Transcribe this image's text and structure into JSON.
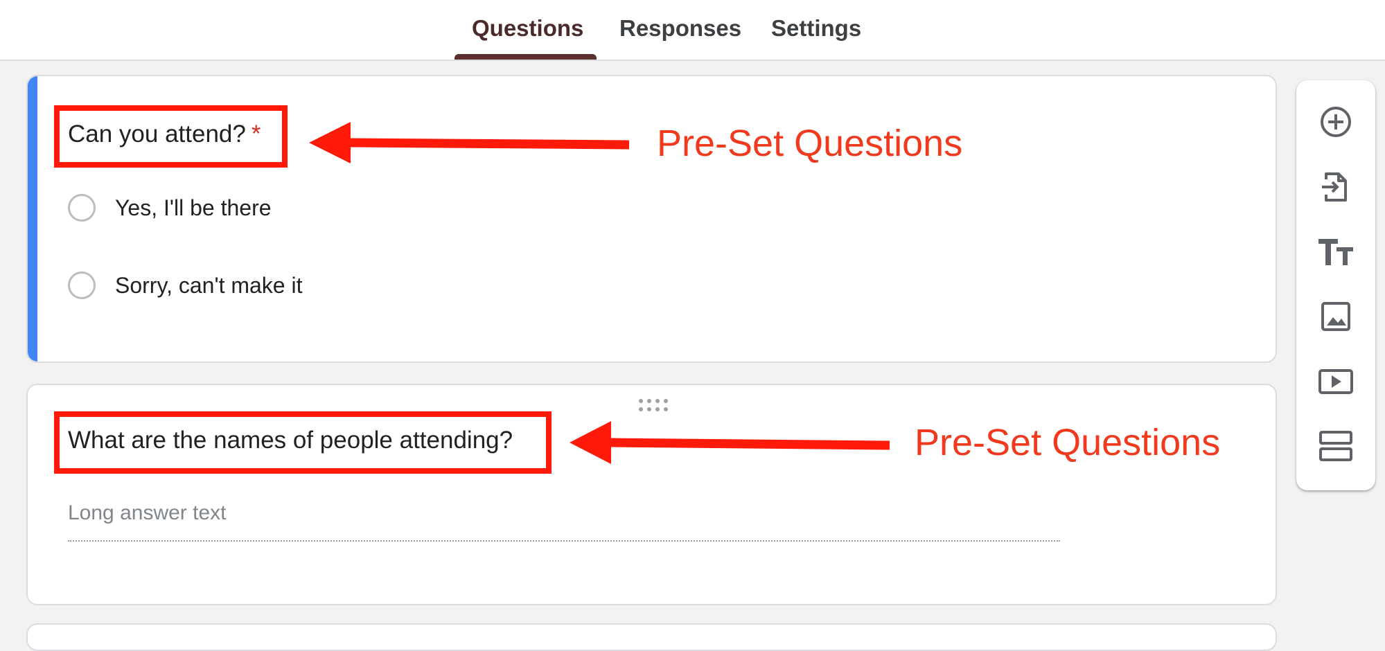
{
  "tabs": [
    {
      "label": "Questions",
      "active": true
    },
    {
      "label": "Responses",
      "active": false
    },
    {
      "label": "Settings",
      "active": false
    }
  ],
  "question1": {
    "title": "Can you attend?",
    "required_marker": "*",
    "options": [
      "Yes,  I'll be there",
      "Sorry, can't make it"
    ]
  },
  "question2": {
    "title": "What are the names of people attending?",
    "answer_placeholder": "Long answer text"
  },
  "annotations": [
    "Pre-Set Questions",
    "Pre-Set Questions"
  ],
  "toolbar": {
    "icons": [
      "add-question-icon",
      "import-questions-icon",
      "add-title-icon",
      "add-image-icon",
      "add-video-icon",
      "add-section-icon"
    ]
  },
  "colors": {
    "accent": "#4285f4",
    "tab_active": "#5b2f2f",
    "annotation": "#ff1a0a",
    "required": "#d93025"
  }
}
